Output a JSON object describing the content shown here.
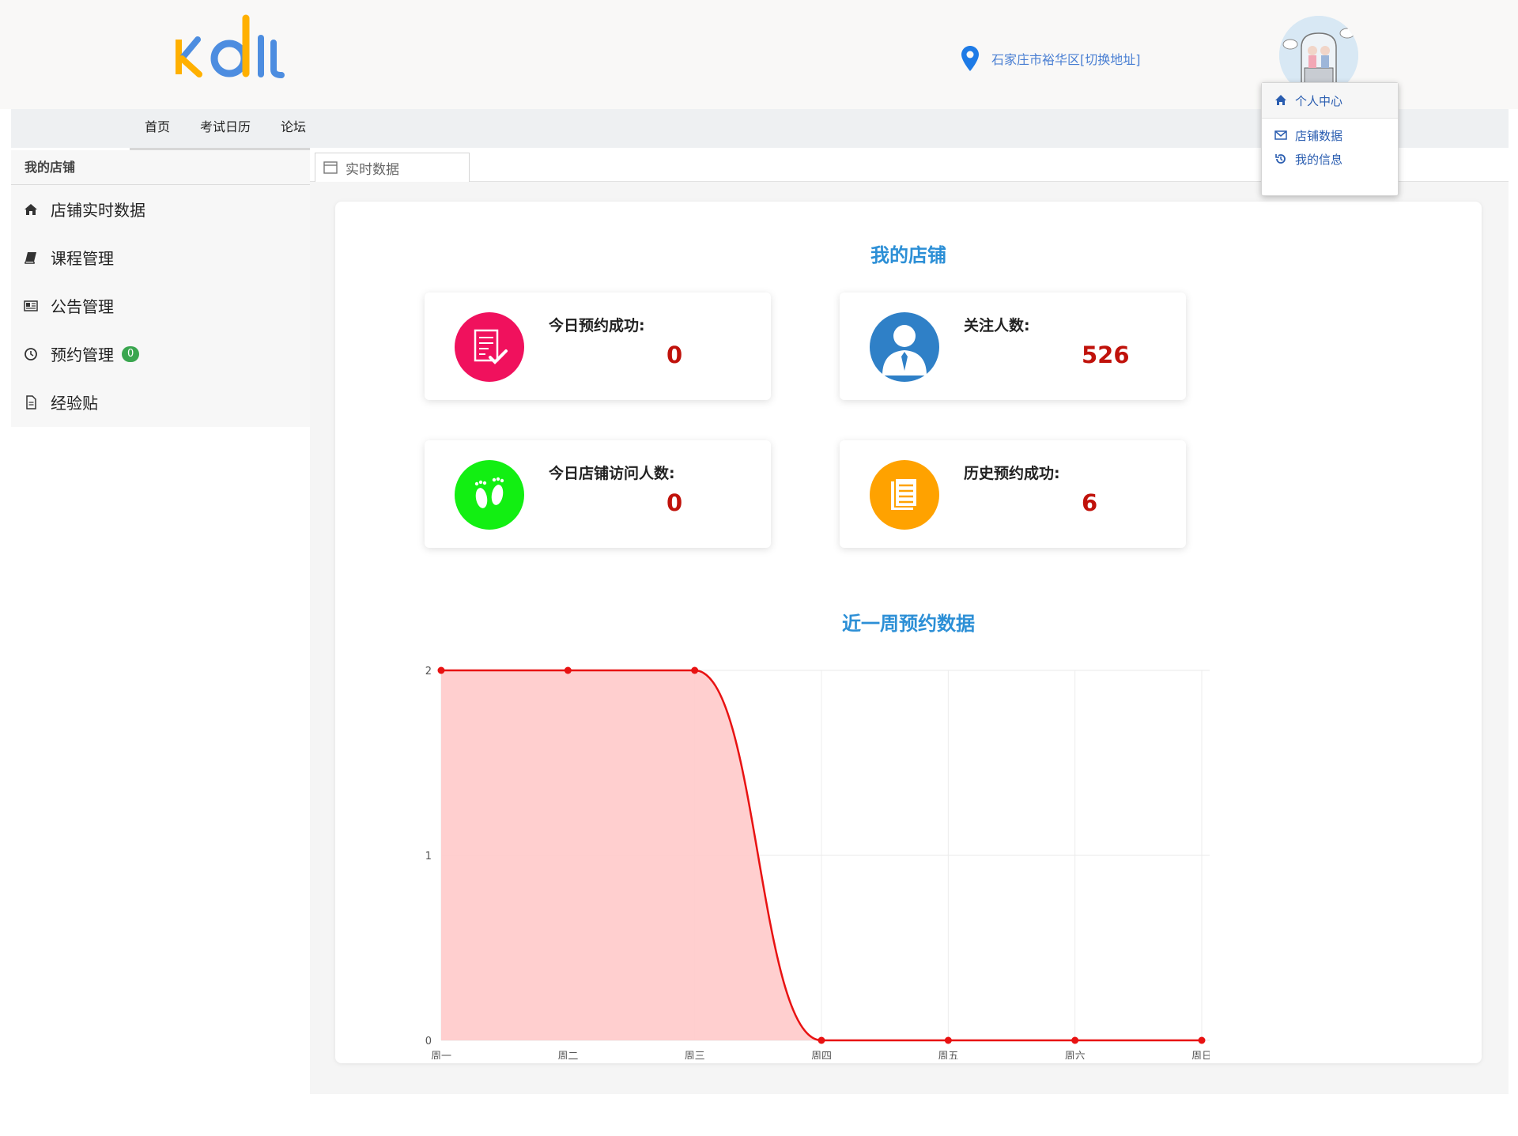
{
  "header": {
    "location_text": "石家庄市裕华区[切换地址]"
  },
  "nav": {
    "items": [
      "首页",
      "考试日历",
      "论坛"
    ]
  },
  "user_menu": {
    "items": [
      {
        "label": "个人中心",
        "icon": "home-icon"
      },
      {
        "label": "店铺数据",
        "icon": "envelope-icon"
      },
      {
        "label": "我的信息",
        "icon": "history-icon"
      }
    ]
  },
  "sidebar": {
    "title": "我的店铺",
    "items": [
      {
        "label": "店铺实时数据",
        "icon": "home-icon"
      },
      {
        "label": "课程管理",
        "icon": "book-icon"
      },
      {
        "label": "公告管理",
        "icon": "newspaper-icon"
      },
      {
        "label": "预约管理",
        "icon": "clock-icon",
        "badge": "0"
      },
      {
        "label": "经验贴",
        "icon": "file-icon"
      }
    ]
  },
  "tab": {
    "label": "实时数据"
  },
  "main": {
    "heading": "我的店铺",
    "cards": [
      {
        "label": "今日预约成功:",
        "value": "0",
        "icon": "checklist-icon",
        "color": "#f0115d"
      },
      {
        "label": "关注人数:",
        "value": "526",
        "icon": "person-icon",
        "color": "#2f80c7"
      },
      {
        "label": "今日店铺访问人数:",
        "value": "0",
        "icon": "footprints-icon",
        "color": "#12ef12"
      },
      {
        "label": "历史预约成功:",
        "value": "6",
        "icon": "document-icon",
        "color": "#ffa200"
      }
    ],
    "chart_heading": "近一周预约数据"
  },
  "chart_data": {
    "type": "area",
    "categories": [
      "周一",
      "周二",
      "周三",
      "周四",
      "周五",
      "周六",
      "周日"
    ],
    "series": [
      {
        "values": [
          2,
          2,
          2,
          0,
          0,
          0,
          0
        ]
      }
    ],
    "ylim": [
      0,
      2
    ],
    "yticks": [
      0,
      1,
      2
    ],
    "grid": true,
    "line_color": "#e81212",
    "fill_color": "#ffcccc"
  }
}
